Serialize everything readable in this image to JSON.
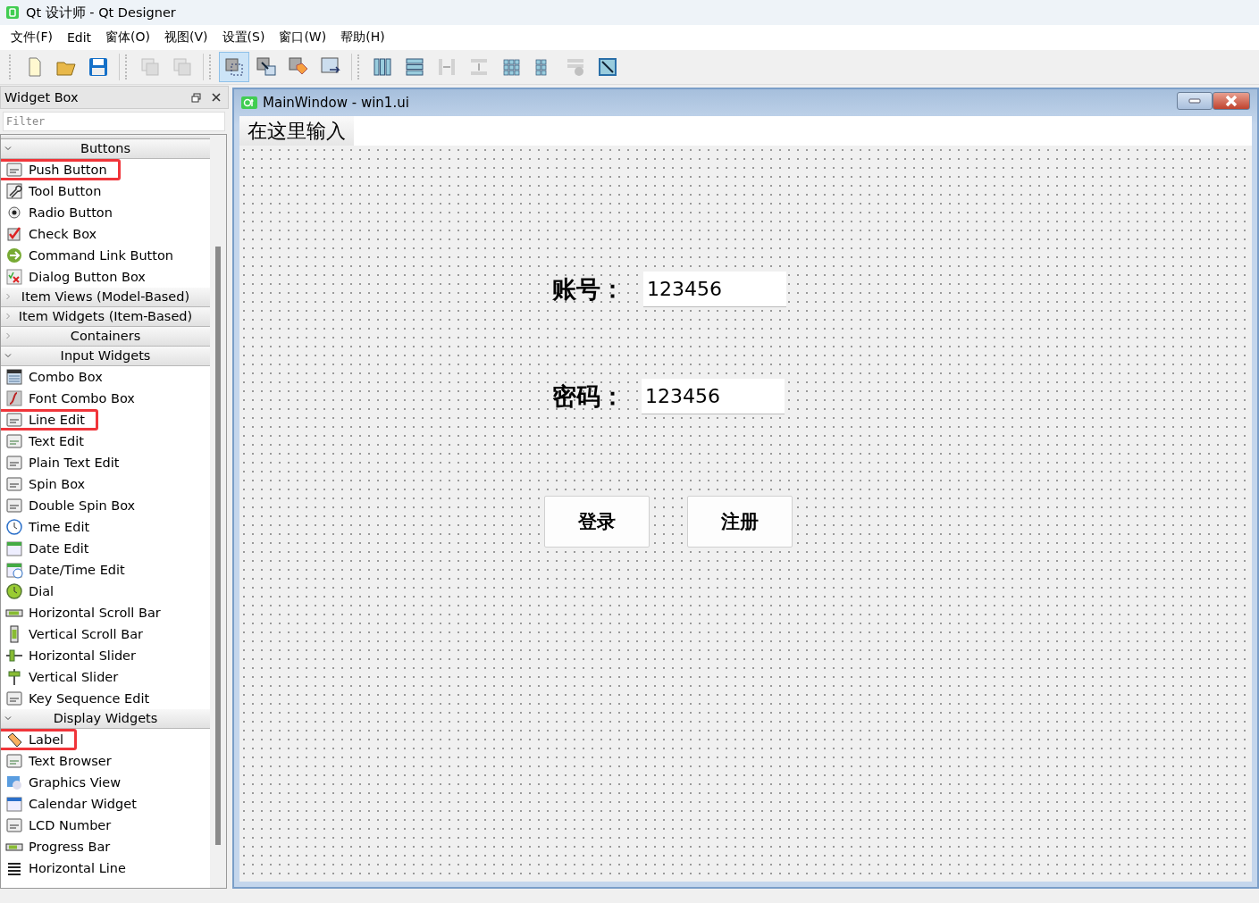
{
  "window": {
    "title": "Qt 设计师 - Qt Designer"
  },
  "menu": [
    "文件(F)",
    "Edit",
    "窗体(O)",
    "视图(V)",
    "设置(S)",
    "窗口(W)",
    "帮助(H)"
  ],
  "toolbar": [
    {
      "selected": false,
      "disabled": false
    },
    {
      "selected": false,
      "disabled": false
    },
    {
      "selected": false,
      "disabled": false
    },
    {
      "selected": false,
      "disabled": true
    },
    {
      "selected": false,
      "disabled": true
    },
    {
      "selected": true,
      "disabled": false
    },
    {
      "selected": false,
      "disabled": false
    },
    {
      "selected": false,
      "disabled": false
    },
    {
      "selected": false,
      "disabled": false
    },
    {
      "selected": false,
      "disabled": false
    },
    {
      "selected": false,
      "disabled": false
    },
    {
      "selected": false,
      "disabled": true
    },
    {
      "selected": false,
      "disabled": true
    },
    {
      "selected": false,
      "disabled": false
    },
    {
      "selected": false,
      "disabled": false
    },
    {
      "selected": false,
      "disabled": true
    },
    {
      "selected": false,
      "disabled": false
    }
  ],
  "widget_box": {
    "title": "Widget Box",
    "filter": {
      "placeholder": "Filter"
    },
    "sections": [
      {
        "label": "Buttons",
        "expanded": true,
        "items": [
          {
            "label": "Push Button",
            "highlighted": true
          },
          {
            "label": "Tool Button",
            "highlighted": false
          },
          {
            "label": "Radio Button",
            "highlighted": false
          },
          {
            "label": "Check Box",
            "highlighted": false
          },
          {
            "label": "Command Link Button",
            "highlighted": false
          },
          {
            "label": "Dialog Button Box",
            "highlighted": false
          }
        ]
      },
      {
        "label": "Item Views (Model-Based)",
        "expanded": false
      },
      {
        "label": "Item Widgets (Item-Based)",
        "expanded": false
      },
      {
        "label": "Containers",
        "expanded": false
      },
      {
        "label": "Input Widgets",
        "expanded": true,
        "items": [
          {
            "label": "Combo Box",
            "highlighted": false
          },
          {
            "label": "Font Combo Box",
            "highlighted": false
          },
          {
            "label": "Line Edit",
            "highlighted": true
          },
          {
            "label": "Text Edit",
            "highlighted": false
          },
          {
            "label": "Plain Text Edit",
            "highlighted": false
          },
          {
            "label": "Spin Box",
            "highlighted": false
          },
          {
            "label": "Double Spin Box",
            "highlighted": false
          },
          {
            "label": "Time Edit",
            "highlighted": false
          },
          {
            "label": "Date Edit",
            "highlighted": false
          },
          {
            "label": "Date/Time Edit",
            "highlighted": false
          },
          {
            "label": "Dial",
            "highlighted": false
          },
          {
            "label": "Horizontal Scroll Bar",
            "highlighted": false
          },
          {
            "label": "Vertical Scroll Bar",
            "highlighted": false
          },
          {
            "label": "Horizontal Slider",
            "highlighted": false
          },
          {
            "label": "Vertical Slider",
            "highlighted": false
          },
          {
            "label": "Key Sequence Edit",
            "highlighted": false
          }
        ]
      },
      {
        "label": "Display Widgets",
        "expanded": true,
        "items": [
          {
            "label": "Label",
            "highlighted": true
          },
          {
            "label": "Text Browser",
            "highlighted": false
          },
          {
            "label": "Graphics View",
            "highlighted": false
          },
          {
            "label": "Calendar Widget",
            "highlighted": false
          },
          {
            "label": "LCD Number",
            "highlighted": false
          },
          {
            "label": "Progress Bar",
            "highlighted": false
          },
          {
            "label": "Horizontal Line",
            "highlighted": false
          }
        ]
      }
    ]
  },
  "form": {
    "title": "MainWindow - win1.ui",
    "menu_placeholder": "在这里输入",
    "widgets": [
      {
        "kind": "label",
        "text": "账号："
      },
      {
        "kind": "input",
        "value": "123456"
      },
      {
        "kind": "label",
        "text": "密码："
      },
      {
        "kind": "input",
        "value": "123456"
      },
      {
        "kind": "button",
        "text": "登录"
      },
      {
        "kind": "button",
        "text": "注册"
      }
    ]
  }
}
